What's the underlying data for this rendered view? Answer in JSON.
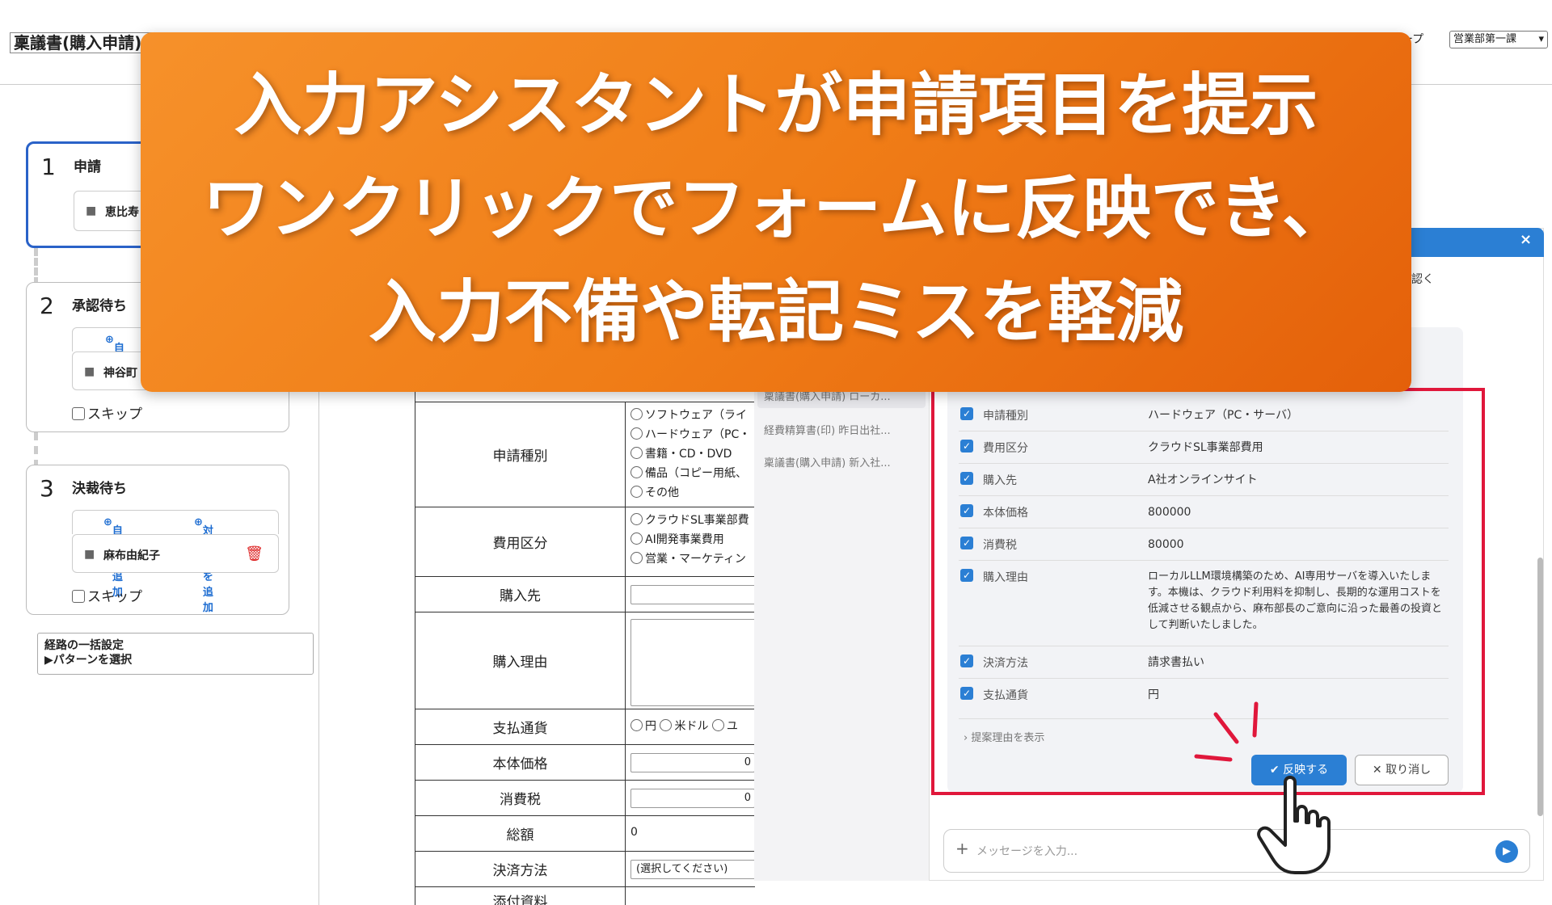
{
  "header": {
    "doc_title": "稟議書(購入申請)",
    "group_label": "ループ",
    "group_value": "営業部第一課"
  },
  "route": {
    "step1": {
      "num": "1",
      "title": "申請",
      "person": "恵比寿"
    },
    "step2": {
      "num": "2",
      "title": "承認待ち",
      "add_self": "自分を",
      "person": "神谷町",
      "skip": "スキップ"
    },
    "step3": {
      "num": "3",
      "title": "決裁待ち",
      "add_self": "自分を追加",
      "add_target": "対象者を追加",
      "person": "麻布由紀子",
      "skip": "スキップ"
    },
    "bulk": {
      "title": "経路の一括設定",
      "pattern": "▶パターンを選択"
    }
  },
  "form": {
    "type_label": "申請種別",
    "type_options": [
      "ソフトウェア（ライ",
      "ハードウェア（PC・",
      "書籍・CD・DVD",
      "備品（コピー用紙、",
      "その他"
    ],
    "cost_label": "費用区分",
    "cost_options": [
      "クラウドSL事業部費",
      "AI開発事業費用",
      "営業・マーケティン"
    ],
    "vendor_label": "購入先",
    "reason_label": "購入理由",
    "currency_label": "支払通貨",
    "currency_options": [
      "円",
      "米ドル",
      "ユ"
    ],
    "price_label": "本体価格",
    "price_value": "0",
    "tax_label": "消費税",
    "tax_value": "0",
    "total_label": "総額",
    "total_value": "0",
    "payment_label": "決済方法",
    "payment_value": "(選択してください)",
    "attach_label": "添付資料"
  },
  "history": [
    "稟議書(購入申請) ローカ...",
    "経費精算書(印) 昨日出社...",
    "稟議書(購入申請) 新入社..."
  ],
  "chat": {
    "close": "×",
    "hint": "認く",
    "proposal": [
      {
        "key": "申請種別",
        "value": "ハードウェア（PC・サーバ）"
      },
      {
        "key": "費用区分",
        "value": "クラウドSL事業部費用"
      },
      {
        "key": "購入先",
        "value": "A社オンラインサイト"
      },
      {
        "key": "本体価格",
        "value": "800000"
      },
      {
        "key": "消費税",
        "value": "80000"
      },
      {
        "key": "購入理由",
        "value": "ローカルLLM環境構築のため、AI専用サーバを導入いたします。本機は、クラウド利用料を抑制し、長期的な運用コストを低減させる観点から、麻布部長のご意向に沿った最善の投資として判断いたしました。"
      },
      {
        "key": "決済方法",
        "value": "請求書払い"
      },
      {
        "key": "支払通貨",
        "value": "円"
      }
    ],
    "show_reason": "提案理由を表示",
    "apply": "反映する",
    "cancel": "取り消し",
    "input_placeholder": "メッセージを入力..."
  },
  "banner": {
    "line1": "入力アシスタントが申請項目を提示",
    "line2": "ワンクリックでフォームに反映でき、",
    "line3": "入力不備や転記ミスを軽減"
  },
  "colors": {
    "accent": "#2b7fd4",
    "banner": "#f07d17",
    "highlight": "#e0173b",
    "danger": "#d22222"
  },
  "icons": [
    "person-icon",
    "plus-circle-icon",
    "trash-icon",
    "close-icon",
    "check-icon",
    "send-icon",
    "pointer-hand-icon"
  ]
}
